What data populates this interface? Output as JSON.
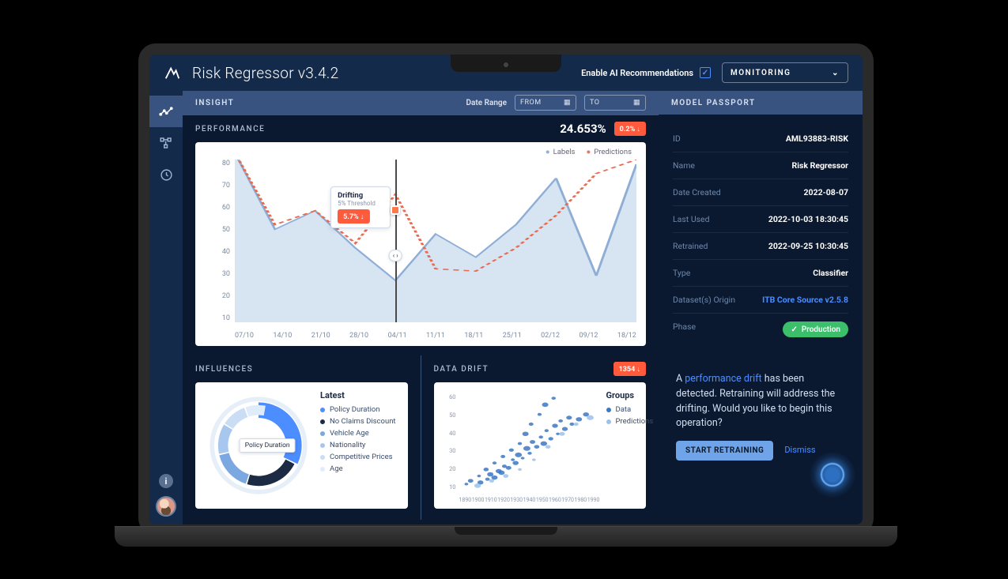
{
  "header": {
    "title": "Risk Regressor v3.4.2",
    "ai_toggle_label": "Enable AI Recommendations",
    "mode": "MONITORING"
  },
  "subheader": {
    "title": "INSIGHT",
    "date_range_label": "Date Range",
    "from_label": "FROM",
    "to_label": "TO"
  },
  "performance": {
    "title": "PERFORMANCE",
    "value": "24.653%",
    "badge": "0.2% ↓",
    "legend_labels": "Labels",
    "legend_predictions": "Predictions",
    "tooltip_title": "Drifting",
    "tooltip_sub": "5% Threshold",
    "tooltip_badge": "5.7% ↓"
  },
  "influences": {
    "title": "INFLUENCES",
    "legend_title": "Latest",
    "hover_label": "Policy Duration",
    "items": [
      {
        "label": "Policy Duration",
        "color": "#4c8dff"
      },
      {
        "label": "No Claims Discount",
        "color": "#1c2a44"
      },
      {
        "label": "Vehicle Age",
        "color": "#7ba8e0"
      },
      {
        "label": "Nationality",
        "color": "#a8c7ee"
      },
      {
        "label": "Competitive Prices",
        "color": "#c9ddf5"
      },
      {
        "label": "Age",
        "color": "#e0ecfa"
      }
    ]
  },
  "datadrift": {
    "title": "DATA DRIFT",
    "badge": "1354 ↓",
    "legend_title": "Groups",
    "legend_data": "Data",
    "legend_predictions": "Predictions"
  },
  "passport": {
    "title": "MODEL PASSPORT",
    "rows": [
      {
        "key": "ID",
        "value": "AML93883-RISK"
      },
      {
        "key": "Name",
        "value": "Risk Regressor"
      },
      {
        "key": "Date Created",
        "value": "2022-08-07"
      },
      {
        "key": "Last Used",
        "value": "2022-10-03  18:30:45"
      },
      {
        "key": "Retrained",
        "value": "2022-09-25  10:30:45"
      },
      {
        "key": "Type",
        "value": "Classifier"
      },
      {
        "key": "Dataset(s) Origin",
        "value": "ITB Core Source v2.5.8",
        "link": true
      },
      {
        "key": "Phase",
        "value": "Production",
        "pill": true
      }
    ]
  },
  "alert": {
    "pre": "A ",
    "highlight": "performance drift",
    "post": " has been detected. Retraining will address the drifting. Would you like to begin this operation?",
    "primary": "START RETRAINING",
    "dismiss": "Dismiss"
  },
  "colors": {
    "labels_area": "#c6d8ec",
    "labels_line": "#8eaed6",
    "pred_line": "#e86a4f",
    "scatter": "#3d77c2"
  },
  "chart_data": [
    {
      "id": "performance",
      "type": "area",
      "x": [
        "07/10",
        "14/10",
        "21/10",
        "28/10",
        "04/11",
        "11/11",
        "18/11",
        "25/11",
        "02/12",
        "09/12",
        "18/12"
      ],
      "ylim": [
        10,
        80
      ],
      "series": [
        {
          "name": "Labels",
          "values": [
            83,
            50,
            58,
            42,
            28,
            48,
            38,
            52,
            72,
            30,
            78
          ]
        },
        {
          "name": "Predictions",
          "values": [
            83,
            52,
            58,
            44,
            65,
            33,
            32,
            42,
            56,
            74,
            80
          ]
        }
      ],
      "drift_marker_x": "04/11"
    },
    {
      "id": "influences",
      "type": "pie",
      "title": "Latest",
      "categories": [
        "Policy Duration",
        "No Claims Discount",
        "Vehicle Age",
        "Nationality",
        "Competitive Prices",
        "Age"
      ],
      "values": [
        32,
        22,
        16,
        12,
        10,
        8
      ]
    },
    {
      "id": "datadrift",
      "type": "scatter",
      "xlabel": "",
      "ylabel": "",
      "xticks": [
        "1890",
        "1900",
        "1910",
        "1920",
        "1930",
        "1940",
        "1950",
        "1960",
        "1970",
        "1980",
        "1990"
      ],
      "yticks": [
        10,
        20,
        30,
        40,
        50,
        60
      ],
      "xlim": [
        1890,
        1990
      ],
      "ylim": [
        5,
        65
      ],
      "series": [
        {
          "name": "Data",
          "points": [
            [
              1895,
              9
            ],
            [
              1898,
              11
            ],
            [
              1905,
              10
            ],
            [
              1904,
              14
            ],
            [
              1910,
              12
            ],
            [
              1909,
              18
            ],
            [
              1912,
              15
            ],
            [
              1915,
              13
            ],
            [
              1918,
              17
            ],
            [
              1915,
              22
            ],
            [
              1920,
              16
            ],
            [
              1922,
              20
            ],
            [
              1921,
              26
            ],
            [
              1925,
              19
            ],
            [
              1928,
              24
            ],
            [
              1927,
              30
            ],
            [
              1930,
              22
            ],
            [
              1932,
              27
            ],
            [
              1933,
              34
            ],
            [
              1935,
              25
            ],
            [
              1938,
              31
            ],
            [
              1937,
              40
            ],
            [
              1940,
              28
            ],
            [
              1942,
              35
            ],
            [
              1941,
              46
            ],
            [
              1945,
              32
            ],
            [
              1948,
              38
            ],
            [
              1947,
              52
            ],
            [
              1950,
              34
            ],
            [
              1952,
              42
            ],
            [
              1951,
              58
            ],
            [
              1955,
              37
            ],
            [
              1958,
              45
            ],
            [
              1957,
              62
            ],
            [
              1960,
              40
            ],
            [
              1962,
              48
            ],
            [
              1965,
              43
            ],
            [
              1968,
              50
            ],
            [
              1970,
              46
            ],
            [
              1975,
              49
            ],
            [
              1980,
              52
            ]
          ]
        },
        {
          "name": "Predictions",
          "points": [
            [
              1903,
              8
            ],
            [
              1913,
              11
            ],
            [
              1923,
              14
            ],
            [
              1933,
              18
            ],
            [
              1943,
              24
            ],
            [
              1953,
              32
            ],
            [
              1963,
              40
            ],
            [
              1973,
              46
            ],
            [
              1983,
              50
            ]
          ]
        }
      ]
    }
  ]
}
